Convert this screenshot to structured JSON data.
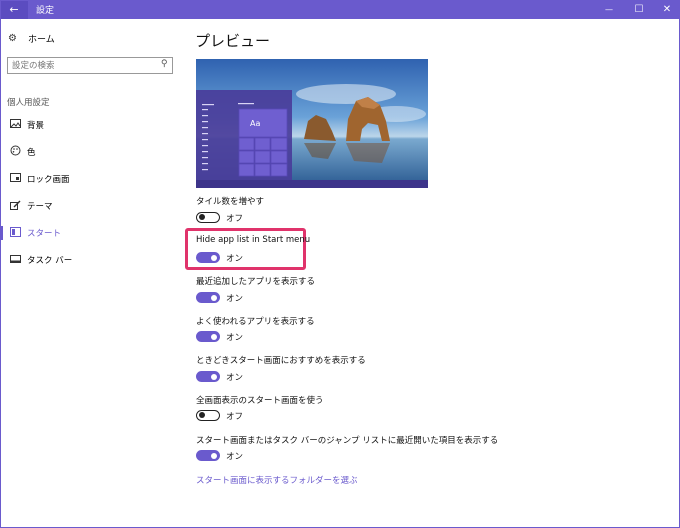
{
  "titlebar": {
    "title": "設定",
    "back_glyph": "←",
    "minimize_glyph": "—",
    "maximize_glyph": "☐",
    "close_glyph": "✕"
  },
  "sidebar": {
    "home_label": "ホーム",
    "search_placeholder": "設定の検索",
    "section_label": "個人用設定",
    "items": [
      {
        "label": "背景",
        "icon": "picture-icon",
        "glyph": "▭"
      },
      {
        "label": "色",
        "icon": "palette-icon",
        "glyph": "◔"
      },
      {
        "label": "ロック画面",
        "icon": "lock-screen-icon",
        "glyph": "▭"
      },
      {
        "label": "テーマ",
        "icon": "theme-icon",
        "glyph": "✎"
      },
      {
        "label": "スタート",
        "icon": "start-icon",
        "glyph": "▤",
        "active": true
      },
      {
        "label": "タスク バー",
        "icon": "taskbar-icon",
        "glyph": "▭"
      }
    ]
  },
  "main": {
    "title": "プレビュー",
    "preview_tile_label": "Aa",
    "settings": [
      {
        "label": "タイル数を増やす",
        "state": "オフ",
        "on": false
      },
      {
        "label": "Hide app list in Start menu",
        "state": "オン",
        "on": true
      },
      {
        "label": "最近追加したアプリを表示する",
        "state": "オン",
        "on": true
      },
      {
        "label": "よく使われるアプリを表示する",
        "state": "オン",
        "on": true
      },
      {
        "label": "ときどきスタート画面におすすめを表示する",
        "state": "オン",
        "on": true
      },
      {
        "label": "全画面表示のスタート画面を使う",
        "state": "オフ",
        "on": false
      },
      {
        "label": "スタート画面またはタスク バーのジャンプ リストに最近開いた項目を表示する",
        "state": "オン",
        "on": true
      }
    ],
    "folders_link": "スタート画面に表示するフォルダーを選ぶ"
  },
  "colors": {
    "accent": "#6a5acd",
    "highlight": "#e0336b"
  }
}
